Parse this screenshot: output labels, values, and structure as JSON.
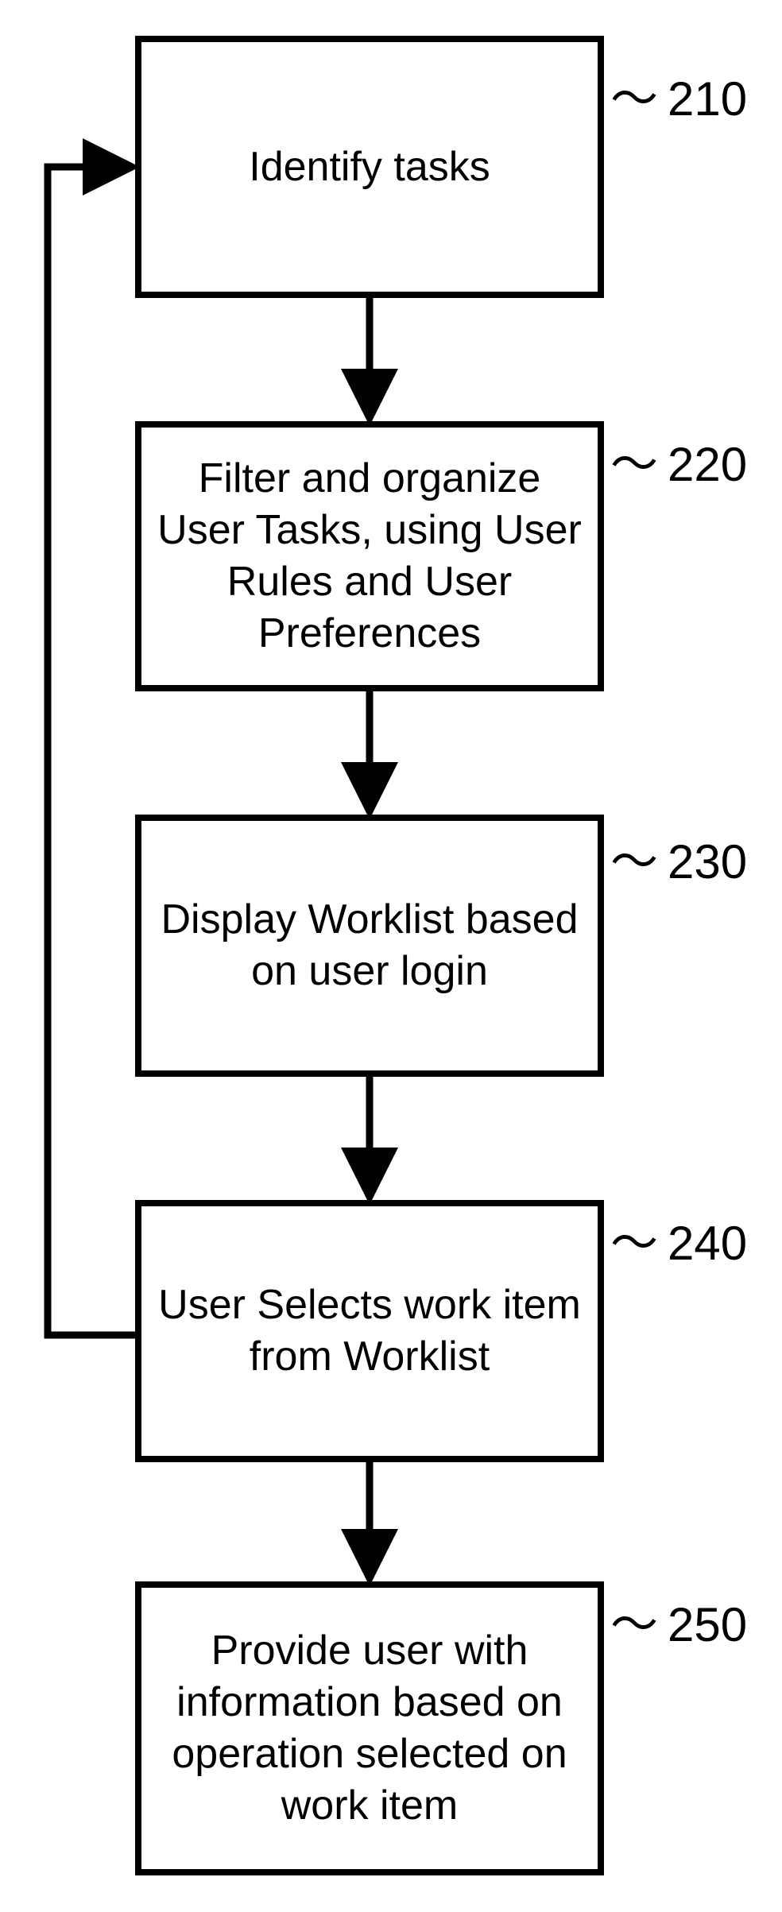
{
  "diagram": {
    "type": "flowchart",
    "nodes": [
      {
        "id": "n210",
        "label": "210",
        "text": "Identify tasks"
      },
      {
        "id": "n220",
        "label": "220",
        "text": "Filter and organize User Tasks, using User Rules and User Preferences"
      },
      {
        "id": "n230",
        "label": "230",
        "text": "Display Worklist based on user login"
      },
      {
        "id": "n240",
        "label": "240",
        "text": "User Selects work item from Worklist"
      },
      {
        "id": "n250",
        "label": "250",
        "text": "Provide user with information based on operation selected on work item"
      }
    ],
    "edges": [
      {
        "from": "n210",
        "to": "n220"
      },
      {
        "from": "n220",
        "to": "n230"
      },
      {
        "from": "n230",
        "to": "n240"
      },
      {
        "from": "n240",
        "to": "n250"
      },
      {
        "from": "n240",
        "to": "n210",
        "type": "feedback"
      }
    ]
  }
}
